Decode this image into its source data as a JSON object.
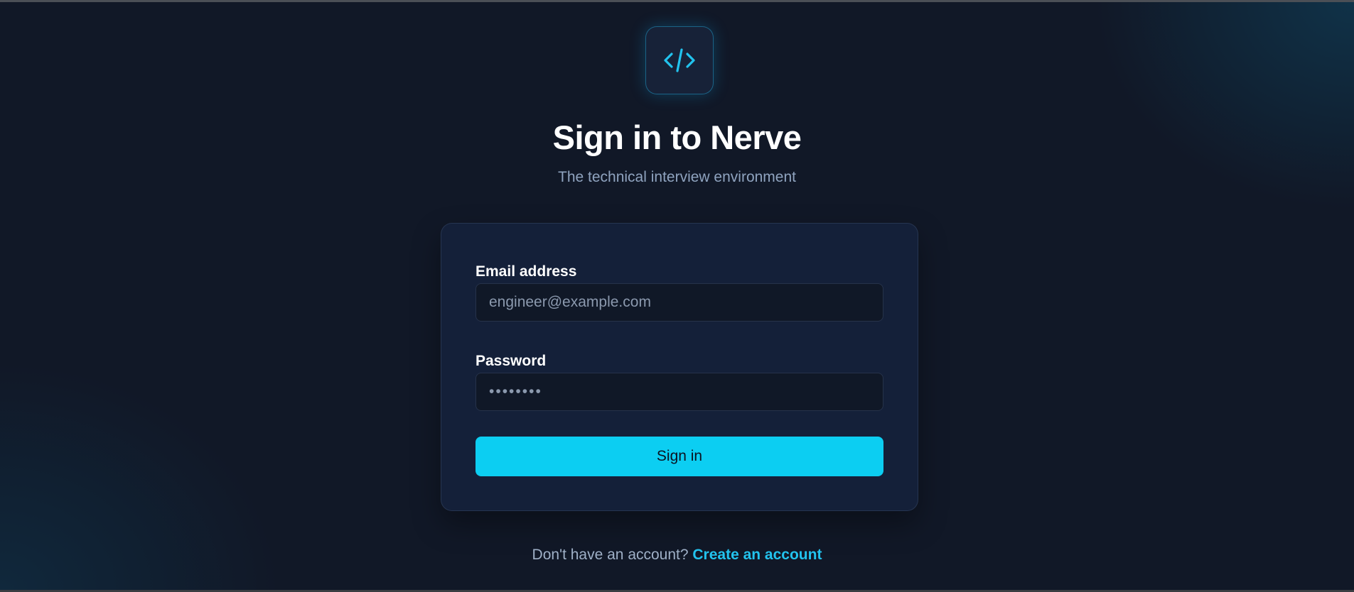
{
  "logo": {
    "icon": "code-brackets-icon",
    "accent_color": "#22c3ee"
  },
  "header": {
    "title": "Sign in to Nerve",
    "subtitle": "The technical interview environment"
  },
  "form": {
    "email": {
      "label": "Email address",
      "placeholder": "engineer@example.com",
      "value": ""
    },
    "password": {
      "label": "Password",
      "placeholder": "••••••••",
      "value": ""
    },
    "submit_label": "Sign in",
    "submit_color": "#0ccef2"
  },
  "footer": {
    "prompt": "Don't have an account?",
    "link_label": "Create an account"
  }
}
